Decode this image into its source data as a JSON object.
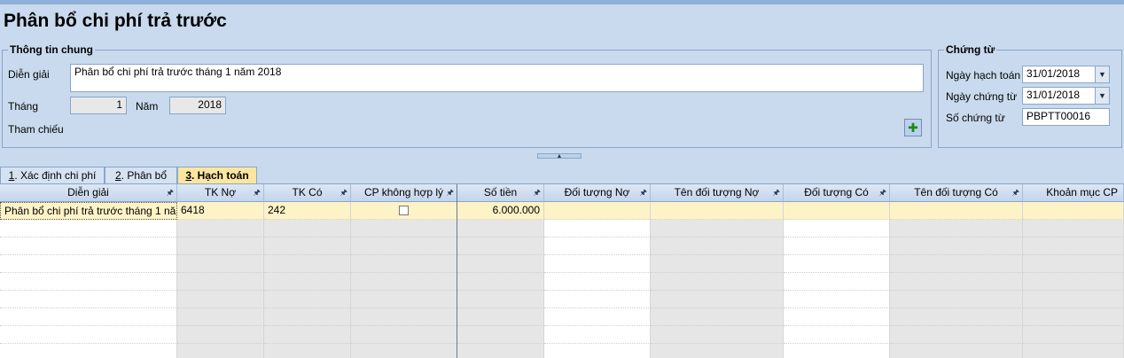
{
  "page_title": "Phân bổ chi phí trả trước",
  "general": {
    "group_title": "Thông tin chung",
    "description_label": "Diễn giải",
    "description_value": "Phân bổ chi phí trả trước tháng 1 năm 2018",
    "month_label": "Tháng",
    "month_value": "1",
    "year_label": "Năm",
    "year_value": "2018",
    "reference_label": "Tham chiếu"
  },
  "voucher": {
    "group_title": "Chứng từ",
    "posting_date_label": "Ngày hạch toán",
    "posting_date_value": "31/01/2018",
    "voucher_date_label": "Ngày chứng từ",
    "voucher_date_value": "31/01/2018",
    "voucher_no_label": "Số chứng từ",
    "voucher_no_value": "PBPTT00016"
  },
  "tabs": [
    {
      "num": "1",
      "label": ". Xác định chi phí"
    },
    {
      "num": "2",
      "label": ". Phân bổ"
    },
    {
      "num": "3",
      "label": ". Hạch toán"
    }
  ],
  "grid": {
    "columns": [
      "Diễn giải",
      "TK Nợ",
      "TK Có",
      "CP không hợp lý",
      "Số tiền",
      "Đối tượng Nợ",
      "Tên đối tượng Nợ",
      "Đối tượng Có",
      "Tên đối tượng Có",
      "Khoản mục CP"
    ],
    "row": {
      "description": "Phân bổ chi phí trả trước tháng 1 nă...",
      "debit_account": "6418",
      "credit_account": "242",
      "amount": "6.000.000"
    }
  },
  "icons": {
    "pin": "pin-icon",
    "dropdown": "chevron-down-icon",
    "reference_add": "add-reference-icon"
  },
  "colors": {
    "background": "#c9daee",
    "active_tab": "#fbe6a0",
    "selected_row": "#fdf3c6"
  }
}
